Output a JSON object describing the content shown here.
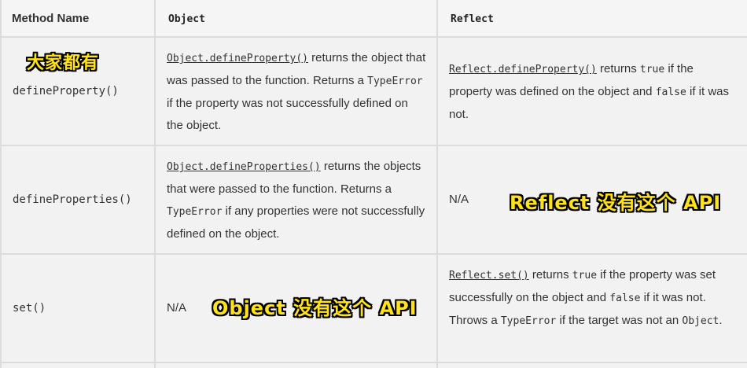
{
  "headers": {
    "method": "Method Name",
    "object": "Object",
    "reflect": "Reflect"
  },
  "rows": [
    {
      "method": "defineProperty()",
      "annotation": "大家都有",
      "object": {
        "link": "Object.defineProperty()",
        "t1": " returns the object that was passed to the function. Returns a ",
        "code1": "TypeError",
        "t2": " if the property was not successfully defined on the object."
      },
      "reflect": {
        "link": "Reflect.defineProperty()",
        "t1": " returns ",
        "code1": "true",
        "t2": " if the property was defined on the object and ",
        "code2": "false",
        "t3": " if it was not."
      }
    },
    {
      "method": "defineProperties()",
      "object": {
        "link": "Object.defineProperties()",
        "t1": " returns the objects that were passed to the function. Returns a ",
        "code1": "TypeError",
        "t2": " if any properties were not successfully defined on the object."
      },
      "reflect": {
        "text": "N/A",
        "annotation": "Reflect 没有这个 API"
      }
    },
    {
      "method": "set()",
      "object": {
        "text": "N/A",
        "annotation": "Object 没有这个 API"
      },
      "reflect": {
        "link": "Reflect.set()",
        "t1": " returns ",
        "code1": "true",
        "t2": " if the property was set successfully on the object and ",
        "code2": "false",
        "t3": " if it was not. Throws a ",
        "code3": "TypeError",
        "t4": " if the target was not an ",
        "code4": "Object",
        "t5": "."
      }
    }
  ]
}
